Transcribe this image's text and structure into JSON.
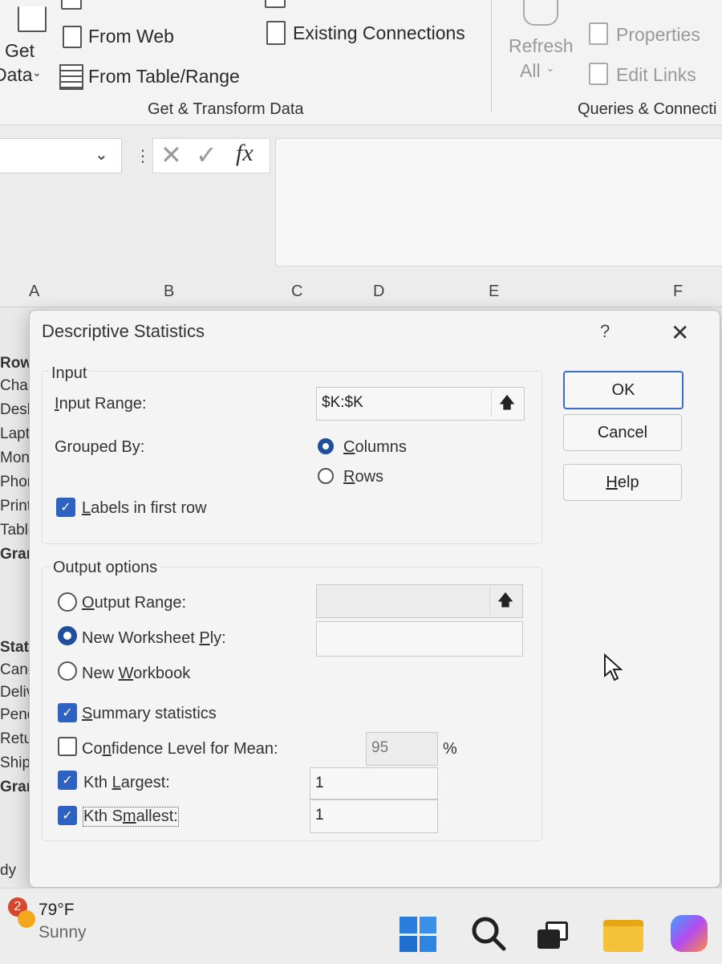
{
  "ribbon": {
    "get_data_1": "Get",
    "get_data_2": "Data",
    "from_web": "From Web",
    "from_table": "From Table/Range",
    "existing_connections": "Existing Connections",
    "group_get_transform": "Get & Transform Data",
    "refresh_1": "Refresh",
    "refresh_2": "All",
    "properties": "Properties",
    "edit_links": "Edit Links",
    "group_queries": "Queries & Connecti"
  },
  "formula_bar": {
    "fx": "fx"
  },
  "columns": [
    "A",
    "B",
    "C",
    "D",
    "E",
    "F"
  ],
  "left_cells": [
    "Row",
    "Chair",
    "Desk",
    "Lapto",
    "Moni",
    "Phon",
    "Printe",
    "Table",
    "Gran",
    "Statu",
    "Canc",
    "Deliv",
    "Pendi",
    "Retur",
    "Shipp",
    "Gran",
    "dy"
  ],
  "dialog": {
    "title": "Descriptive Statistics",
    "help_mark": "?",
    "input_group": "Input",
    "input_range_label": "Input Range:",
    "input_range_value": "$K:$K",
    "grouped_by_label": "Grouped By:",
    "columns_option": "Columns",
    "rows_option": "Rows",
    "labels_first_row": "Labels in first row",
    "output_group": "Output options",
    "output_range": "Output Range:",
    "new_worksheet_ply": "New Worksheet Ply:",
    "new_workbook": "New Workbook",
    "summary_statistics": "Summary statistics",
    "confidence_level": "Confidence Level for Mean:",
    "confidence_value": "95",
    "percent": "%",
    "kth_largest": "Kth Largest:",
    "kth_largest_value": "1",
    "kth_smallest": "Kth Smallest:",
    "kth_smallest_value": "1",
    "ok": "OK",
    "cancel": "Cancel",
    "help": "Help"
  },
  "taskbar": {
    "badge": "2",
    "temperature": "79°F",
    "condition": "Sunny"
  },
  "colors": {
    "accent": "#2e62c0",
    "ok_border": "#3c6ec5"
  }
}
